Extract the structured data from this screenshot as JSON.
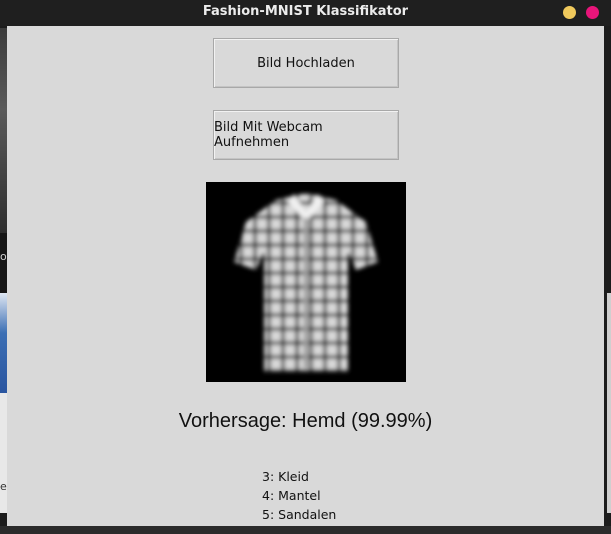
{
  "window": {
    "title": "Fashion-MNIST Klassifikator",
    "controls": {
      "minimize_color": "#f0c95c",
      "close_color": "#e8157a"
    }
  },
  "buttons": {
    "upload_label": "Bild Hochladen",
    "webcam_label": "Bild Mit Webcam Aufnehmen"
  },
  "image": {
    "description_icon": "shirt-image"
  },
  "prediction": {
    "text": "Vorhersage: Hemd (99.99%)"
  },
  "classes": [
    "3: Kleid",
    "4: Mantel",
    "5: Sandalen"
  ],
  "background_fragments": {
    "left_glyph": "o",
    "left_glyph_bottom": "e"
  }
}
